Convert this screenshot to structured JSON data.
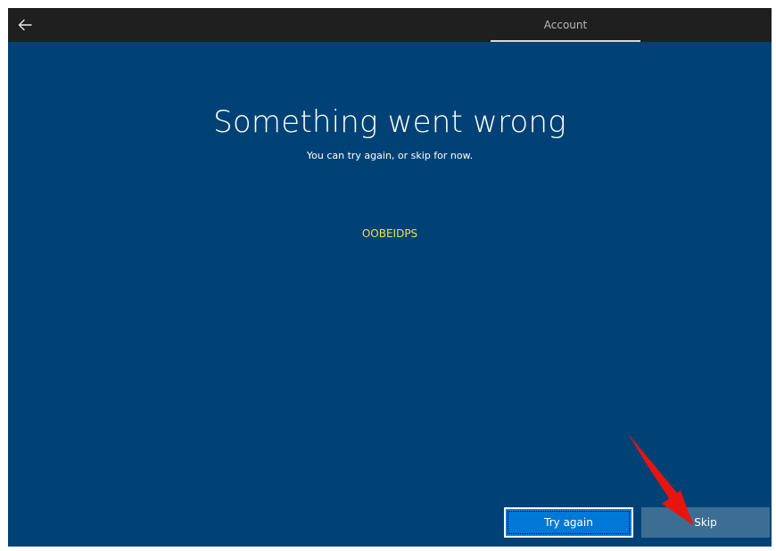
{
  "header": {
    "back_icon": "back-arrow-icon",
    "tab_label": "Account"
  },
  "main": {
    "title": "Something went wrong",
    "subtitle": "You can try again, or skip for now.",
    "error_code": "OOBEIDPS"
  },
  "footer": {
    "try_again_label": "Try again",
    "skip_label": "Skip"
  },
  "colors": {
    "background": "#004275",
    "topbar": "#1f1f1f",
    "accent": "#0078d7",
    "error_code": "#e8e34a",
    "annotation_arrow": "#e8140f"
  }
}
